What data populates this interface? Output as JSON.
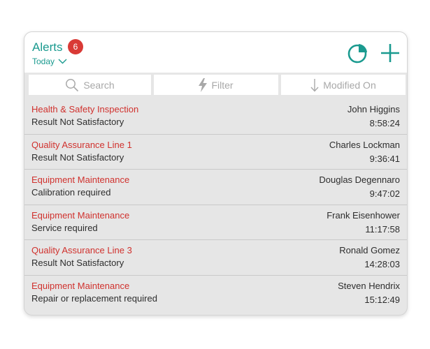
{
  "header": {
    "title": "Alerts",
    "badge_count": "6",
    "period_label": "Today",
    "accent_color": "#1a9a8f",
    "badge_color": "#d93a36",
    "pie_icon": "pie-chart-icon",
    "add_icon": "plus-icon"
  },
  "toolbar": {
    "search_label": "Search",
    "filter_label": "Filter",
    "sort_label": "Modified On"
  },
  "alerts": [
    {
      "title": "Health & Safety Inspection",
      "detail": "Result Not Satisfactory",
      "name": "John Higgins",
      "time": "8:58:24"
    },
    {
      "title": "Quality Assurance Line 1",
      "detail": "Result Not Satisfactory",
      "name": "Charles Lockman",
      "time": "9:36:41"
    },
    {
      "title": "Equipment Maintenance",
      "detail": "Calibration required",
      "name": "Douglas Degennaro",
      "time": "9:47:02"
    },
    {
      "title": "Equipment Maintenance",
      "detail": "Service required",
      "name": "Frank Eisenhower",
      "time": "11:17:58"
    },
    {
      "title": "Quality Assurance Line 3",
      "detail": "Result Not Satisfactory",
      "name": "Ronald Gomez",
      "time": "14:28:03"
    },
    {
      "title": "Equipment Maintenance",
      "detail": "Repair or replacement required",
      "name": "Steven Hendrix",
      "time": "15:12:49"
    }
  ]
}
